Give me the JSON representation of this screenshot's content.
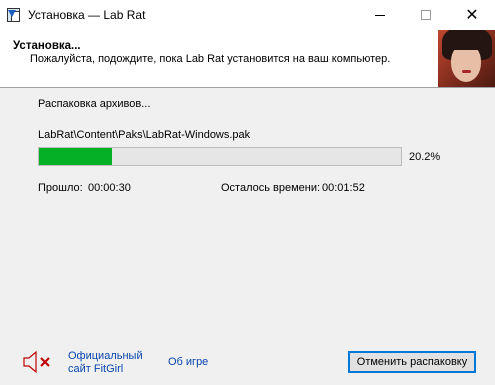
{
  "window": {
    "title": "Установка — Lab Rat",
    "minimize_icon": "minimize-icon",
    "maximize_icon": "maximize-icon",
    "close_icon": "close-icon",
    "close_glyph": "✕"
  },
  "header": {
    "title": "Установка...",
    "subtitle": "Пожалуйста, подождите, пока Lab Rat установится на ваш компьютер.",
    "image_icon": "portrait-image"
  },
  "progress": {
    "status": "Распаковка архивов...",
    "current_file": "LabRat\\Content\\Paks\\LabRat-Windows.pak",
    "fraction": 0.202,
    "percent_text": "20.2%",
    "fill_color": "#06b025",
    "elapsed_label": "Прошло:",
    "elapsed_value": "00:00:30",
    "remaining_label": "Осталось времени:",
    "remaining_value": "00:01:52"
  },
  "footer": {
    "mute_icon": "speaker-muted-icon",
    "fitgirl_line1": "Официальный",
    "fitgirl_line2": "сайт FitGirl",
    "about_label": "Об игре",
    "cancel_label": "Отменить распаковку",
    "link_color": "#0645ad"
  }
}
